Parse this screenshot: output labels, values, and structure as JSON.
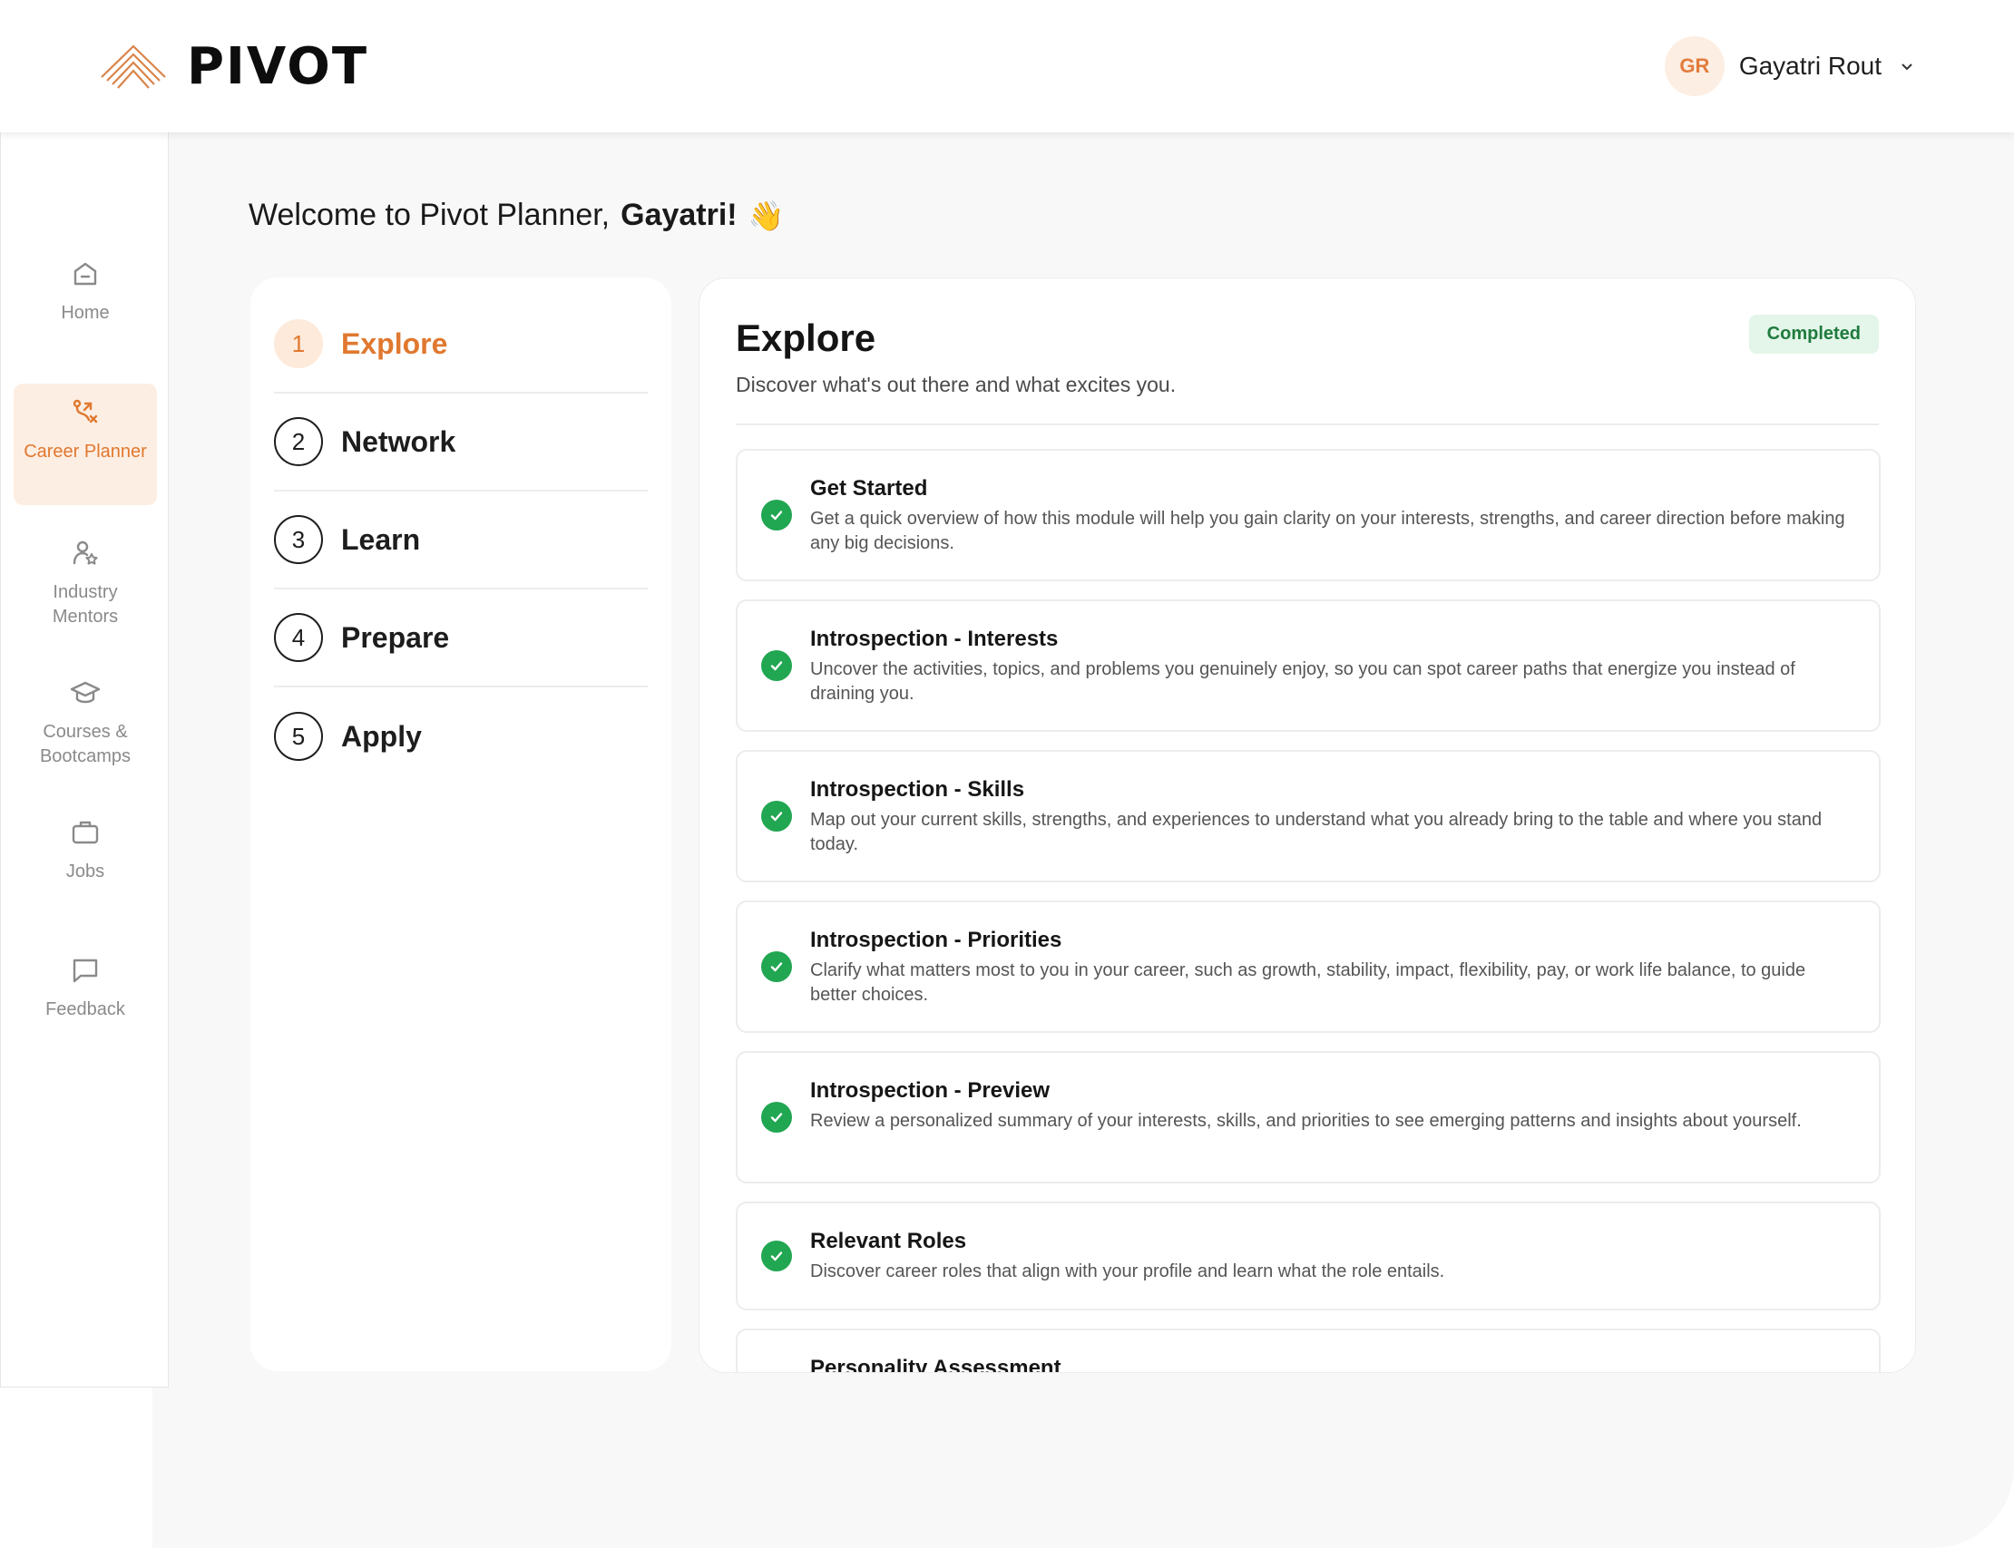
{
  "header": {
    "brand": "PIVOT",
    "user_initials": "GR",
    "user_name": "Gayatri Rout"
  },
  "sidebar": {
    "items": [
      {
        "label": "Home",
        "icon": "home-icon",
        "active": false
      },
      {
        "label": "Career Planner",
        "icon": "route-icon",
        "active": true
      },
      {
        "label": "Industry Mentors",
        "icon": "mentor-icon",
        "active": false
      },
      {
        "label": "Courses & Bootcamps",
        "icon": "graduation-cap-icon",
        "active": false
      },
      {
        "label": "Jobs",
        "icon": "briefcase-icon",
        "active": false
      },
      {
        "label": "Feedback",
        "icon": "message-icon",
        "active": false
      }
    ]
  },
  "welcome": {
    "prefix": "Welcome to Pivot Planner,",
    "name": "Gayatri!",
    "emoji": "👋"
  },
  "steps": [
    {
      "number": "1",
      "label": "Explore",
      "active": true
    },
    {
      "number": "2",
      "label": "Network",
      "active": false
    },
    {
      "number": "3",
      "label": "Learn",
      "active": false
    },
    {
      "number": "4",
      "label": "Prepare",
      "active": false
    },
    {
      "number": "5",
      "label": "Apply",
      "active": false
    }
  ],
  "detail": {
    "title": "Explore",
    "subtitle": "Discover what's out there and what excites you.",
    "status": "Completed",
    "colors": {
      "accent": "#e0782f",
      "success": "#21a652",
      "badge_bg": "#e3f6e9"
    },
    "modules": [
      {
        "title": "Get Started",
        "description": "Get a quick overview of how this module will help you gain clarity on your interests, strengths, and career direction before making any big decisions.",
        "completed": true
      },
      {
        "title": "Introspection - Interests",
        "description": "Uncover the activities, topics, and problems you genuinely enjoy, so you can spot career paths that energize you instead of draining you.",
        "completed": true
      },
      {
        "title": "Introspection - Skills",
        "description": "Map out your current skills, strengths, and experiences to understand what you already bring to the table and where you stand today.",
        "completed": true
      },
      {
        "title": "Introspection - Priorities",
        "description": "Clarify what matters most to you in your career, such as growth, stability, impact, flexibility, pay, or work life balance, to guide better choices.",
        "completed": true
      },
      {
        "title": "Introspection - Preview",
        "description": "Review a personalized summary of your interests, skills, and priorities to see emerging patterns and insights about yourself.",
        "completed": true
      },
      {
        "title": "Relevant Roles",
        "description": "Discover career roles that align with your profile and learn what the role entails.",
        "completed": true
      },
      {
        "title": "Personality Assessment",
        "description": "",
        "completed": false
      }
    ]
  }
}
